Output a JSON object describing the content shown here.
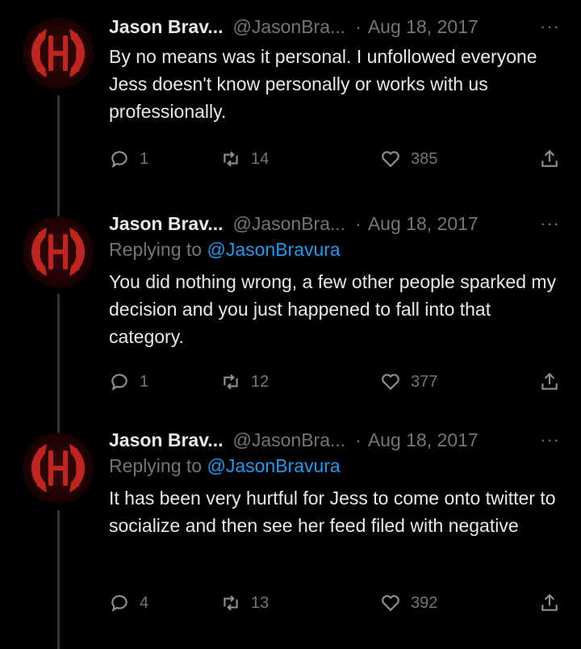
{
  "tweets": [
    {
      "display_name": "Jason Brav...",
      "handle": "@JasonBra...",
      "separator": "·",
      "date": "Aug 18, 2017",
      "more": "···",
      "reply_prefix": "",
      "reply_mention": "",
      "text": "By no means was it personal. I unfollowed everyone Jess doesn't know personally or works with us professionally.",
      "replies": "1",
      "retweets": "14",
      "likes": "385"
    },
    {
      "display_name": "Jason Brav...",
      "handle": "@JasonBra...",
      "separator": "·",
      "date": "Aug 18, 2017",
      "more": "···",
      "reply_prefix": "Replying to ",
      "reply_mention": "@JasonBravura",
      "text": "You did nothing wrong, a few other people sparked my decision and you just happened to fall into that category.",
      "replies": "1",
      "retweets": "12",
      "likes": "377"
    },
    {
      "display_name": "Jason Brav...",
      "handle": "@JasonBra...",
      "separator": "·",
      "date": "Aug 18, 2017",
      "more": "···",
      "reply_prefix": "Replying to ",
      "reply_mention": "@JasonBravura",
      "text": "It has been very hurtful for Jess to come onto twitter to socialize and then see her feed filed with negative",
      "replies": "4",
      "retweets": "13",
      "likes": "392"
    }
  ],
  "icons": {
    "reply": "reply-icon",
    "retweet": "retweet-icon",
    "like": "heart-icon",
    "share": "share-icon",
    "more": "more-icon"
  },
  "colors": {
    "background": "#000000",
    "text": "#e7e9ea",
    "muted": "#71767b",
    "mention": "#1d9bf0",
    "avatar_accent": "#c0261d"
  }
}
